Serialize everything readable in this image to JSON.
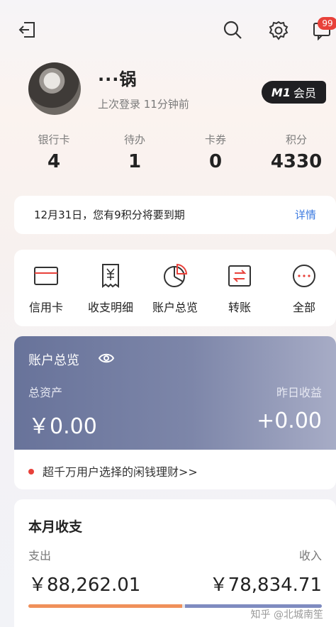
{
  "header": {
    "message_badge": "99",
    "icons": [
      "logout-icon",
      "search-icon",
      "gear-icon",
      "message-icon"
    ]
  },
  "profile": {
    "name": "···锅",
    "last_login": "上次登录 11分钟前",
    "member_level": "M1",
    "member_label": "会员"
  },
  "stats": [
    {
      "label": "银行卡",
      "value": "4"
    },
    {
      "label": "待办",
      "value": "1"
    },
    {
      "label": "卡券",
      "value": "0"
    },
    {
      "label": "积分",
      "value": "4330"
    }
  ],
  "notice": {
    "text": "12月31日，您有9积分将要到期",
    "link": "详情"
  },
  "quick_menu": [
    {
      "label": "信用卡",
      "icon": "credit-card-icon"
    },
    {
      "label": "收支明细",
      "icon": "receipt-icon"
    },
    {
      "label": "账户总览",
      "icon": "pie-chart-icon"
    },
    {
      "label": "转账",
      "icon": "transfer-icon"
    },
    {
      "label": "全部",
      "icon": "more-icon"
    }
  ],
  "overview": {
    "title": "账户总览",
    "total_label": "总资产",
    "total_value": "￥0.00",
    "yesterday_label": "昨日收益",
    "yesterday_value": "+0.00"
  },
  "promo": {
    "text": "超千万用户选择的闲钱理财>>"
  },
  "monthly": {
    "title": "本月收支",
    "expense_label": "支出",
    "expense_value": "￥88,262.01",
    "income_label": "收入",
    "income_value": "￥78,834.71",
    "expense_amount": 88262.01,
    "income_amount": 78834.71
  },
  "watermark": "知乎 @北城南笙",
  "colors": {
    "accent_blue": "#3d7be0",
    "alert_red": "#e8413a",
    "expense_orange": "#f0905a",
    "income_blue": "#7f8cc0"
  }
}
